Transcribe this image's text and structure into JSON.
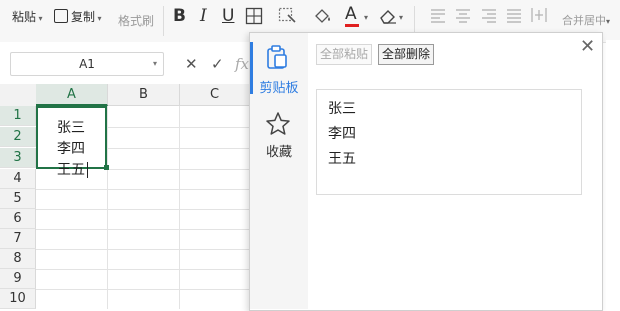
{
  "ribbon": {
    "paste": "粘贴",
    "copy": "复制",
    "format_painter": "格式刷",
    "bold": "B",
    "italic": "I",
    "underline": "U",
    "font_color_letter": "A",
    "merge_center": "合并居中"
  },
  "formula_bar": {
    "name_box": "A1",
    "fx": "fx"
  },
  "grid": {
    "columns": [
      "A",
      "B",
      "C"
    ],
    "rows": [
      "1",
      "2",
      "3",
      "4",
      "5",
      "6",
      "7",
      "8",
      "9",
      "10"
    ],
    "cell_a1_lines": [
      "张三",
      "李四",
      "王五"
    ]
  },
  "clipboard_panel": {
    "tab_clipboard": "剪贴板",
    "tab_favorites": "收藏",
    "paste_all": "全部粘贴",
    "delete_all": "全部删除",
    "items": [
      {
        "lines": [
          "张三",
          "李四",
          "王五"
        ]
      }
    ]
  },
  "colors": {
    "accent_green": "#217346",
    "accent_blue": "#2f7de1",
    "font_color_red": "#e02020"
  }
}
